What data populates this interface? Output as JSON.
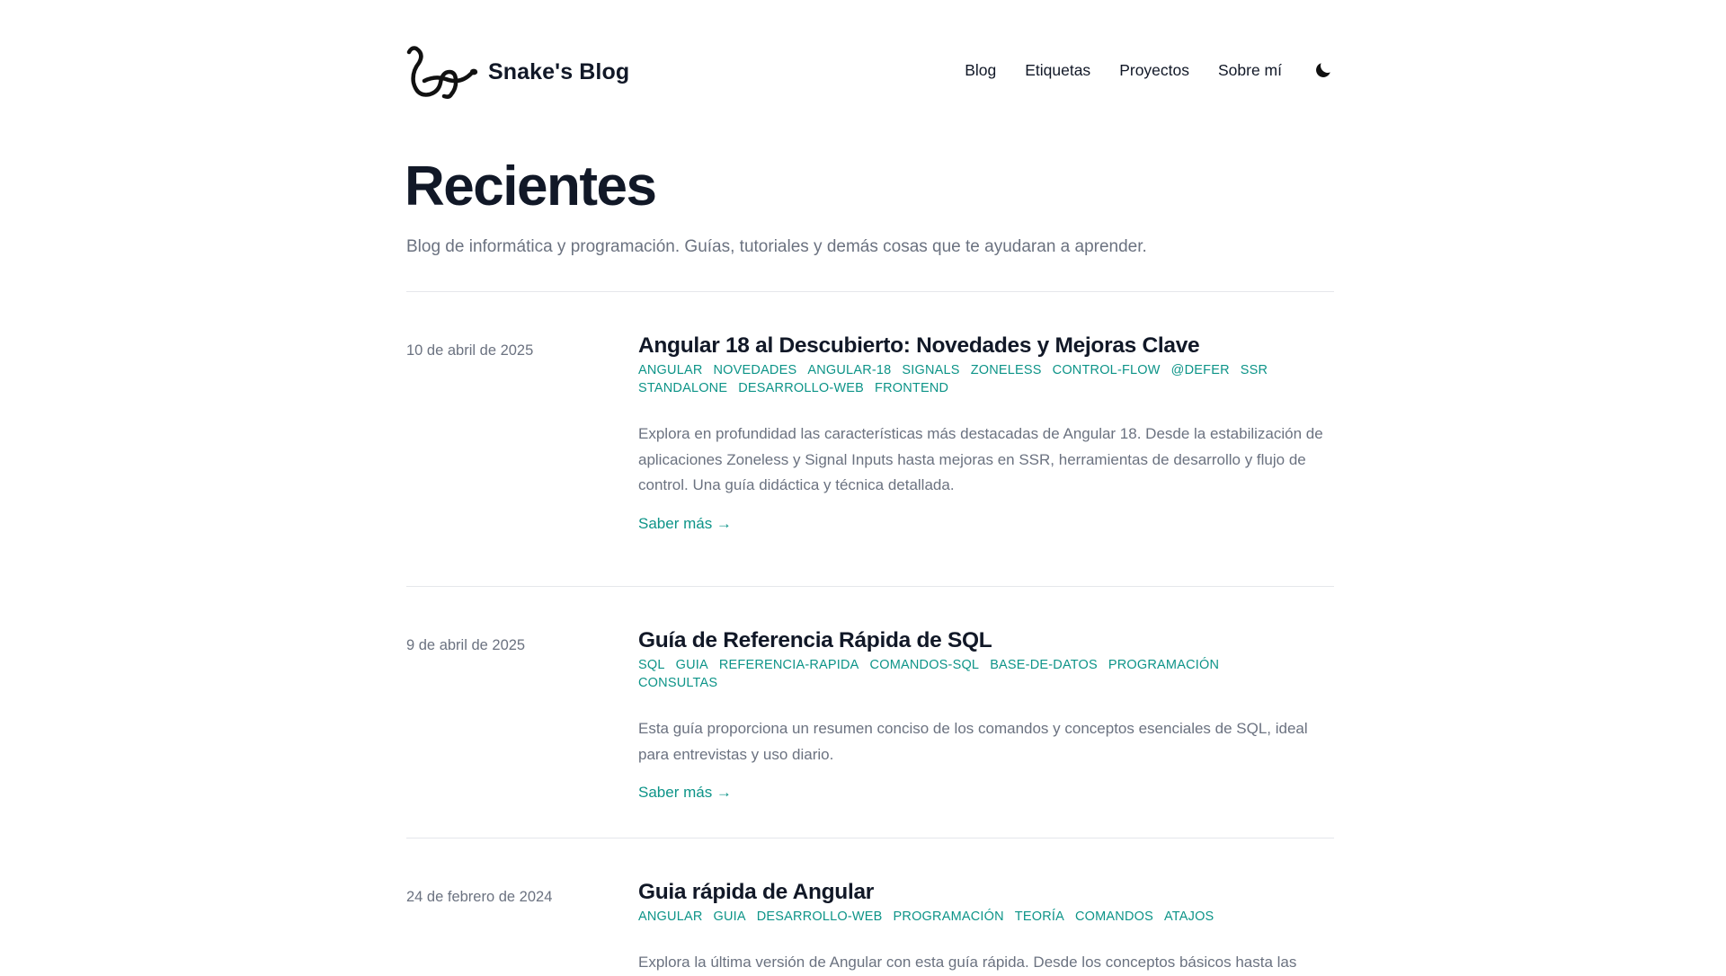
{
  "header": {
    "site_title": "Snake's Blog",
    "logo_icon": "snake-logo-icon",
    "nav": [
      {
        "label": "Blog"
      },
      {
        "label": "Etiquetas"
      },
      {
        "label": "Proyectos"
      },
      {
        "label": "Sobre mí"
      }
    ],
    "theme_toggle_icon": "moon-icon"
  },
  "main": {
    "title": "Recientes",
    "subtitle": "Blog de informática y programación. Guías, tutoriales y demás cosas que te ayudaran a aprender.",
    "read_more_label": "Saber más →",
    "posts": [
      {
        "date": "10 de abril de 2025",
        "title": "Angular 18 al Descubierto: Novedades y Mejoras Clave",
        "tags": [
          "ANGULAR",
          "NOVEDADES",
          "ANGULAR-18",
          "SIGNALS",
          "ZONELESS",
          "CONTROL-FLOW",
          "@DEFER",
          "SSR",
          "STANDALONE",
          "DESARROLLO-WEB",
          "FRONTEND"
        ],
        "excerpt": "Explora en profundidad las características más destacadas de Angular 18. Desde la estabilización de aplicaciones Zoneless y Signal Inputs hasta mejoras en SSR, herramientas de desarrollo y flujo de control. Una guía didáctica y técnica detallada."
      },
      {
        "date": "9 de abril de 2025",
        "title": "Guía de Referencia Rápida de SQL",
        "tags": [
          "SQL",
          "GUIA",
          "REFERENCIA-RAPIDA",
          "COMANDOS-SQL",
          "BASE-DE-DATOS",
          "PROGRAMACIÓN",
          "CONSULTAS"
        ],
        "excerpt": "Esta guía proporciona un resumen conciso de los comandos y conceptos esenciales de SQL, ideal para entrevistas y uso diario."
      },
      {
        "date": "24 de febrero de 2024",
        "title": "Guia rápida de Angular",
        "tags": [
          "ANGULAR",
          "GUIA",
          "DESARROLLO-WEB",
          "PROGRAMACIÓN",
          "TEORÍA",
          "COMANDOS",
          "ATAJOS"
        ],
        "excerpt": "Explora la última versión de Angular con esta guía rápida. Desde los conceptos básicos hasta las"
      }
    ]
  },
  "colors": {
    "accent": "#0d9488",
    "text": "#111827",
    "muted": "#6b7280",
    "divider": "#e5e7eb"
  }
}
